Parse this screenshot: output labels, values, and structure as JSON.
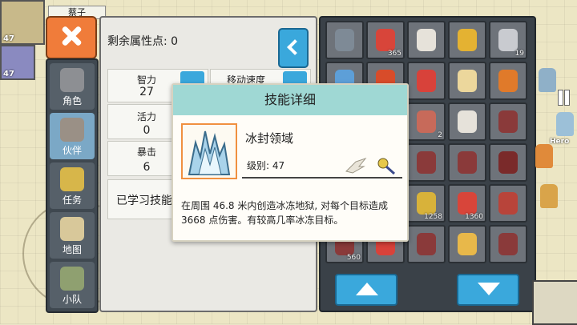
{
  "player": {
    "name": "蔡子",
    "portraits": [
      {
        "level": "47"
      },
      {
        "level": "47"
      }
    ]
  },
  "side_menu": {
    "items": [
      {
        "label": "角色",
        "icon": "helmet-icon"
      },
      {
        "label": "伙伴",
        "icon": "horned-helmet-icon"
      },
      {
        "label": "任务",
        "icon": "trophy-icon"
      },
      {
        "label": "地图",
        "icon": "scroll-map-icon"
      },
      {
        "label": "小队",
        "icon": "party-icon"
      }
    ]
  },
  "attributes": {
    "remaining_label": "剩余属性点: 0",
    "stats": [
      {
        "label": "智力",
        "value": "27"
      },
      {
        "label": "移动速度",
        "value": ""
      },
      {
        "label": "活力",
        "value": "0"
      },
      {
        "label": "暴击",
        "value": "6"
      }
    ],
    "learned_label": "已学习技能"
  },
  "inventory": {
    "slots": [
      {
        "icon": "bow-icon",
        "count": ""
      },
      {
        "icon": "red-potion-icon",
        "count": "365"
      },
      {
        "icon": "white-crystal-icon",
        "count": ""
      },
      {
        "icon": "gold-ring-icon",
        "count": ""
      },
      {
        "icon": "iron-ingot-icon",
        "count": "19"
      },
      {
        "icon": "blue-bow-icon",
        "count": ""
      },
      {
        "icon": "scroll-icon",
        "count": ""
      },
      {
        "icon": "red-gem-icon",
        "count": ""
      },
      {
        "icon": "yellow-crystal-icon",
        "count": ""
      },
      {
        "icon": "orange-mask-icon",
        "count": ""
      },
      {
        "icon": "",
        "count": ""
      },
      {
        "icon": "",
        "count": ""
      },
      {
        "icon": "meat-icon",
        "count": "2"
      },
      {
        "icon": "white-crystal-icon",
        "count": ""
      },
      {
        "icon": "spell-book-icon",
        "count": ""
      },
      {
        "icon": "",
        "count": ""
      },
      {
        "icon": "",
        "count": ""
      },
      {
        "icon": "spell-book-icon",
        "count": ""
      },
      {
        "icon": "spell-book-icon",
        "count": ""
      },
      {
        "icon": "red-armor-icon",
        "count": ""
      },
      {
        "icon": "",
        "count": ""
      },
      {
        "icon": "",
        "count": ""
      },
      {
        "icon": "gold-key-icon",
        "count": "1258"
      },
      {
        "icon": "red-potion-icon",
        "count": "1360"
      },
      {
        "icon": "red-feather-icon",
        "count": ""
      },
      {
        "icon": "spell-book-icon",
        "count": "560"
      },
      {
        "icon": "red-gem-icon",
        "count": ""
      },
      {
        "icon": "spell-book-icon",
        "count": ""
      },
      {
        "icon": "yellow-gem-icon",
        "count": ""
      },
      {
        "icon": "spell-book-icon",
        "count": ""
      }
    ]
  },
  "right_strip": {
    "hero_label": "Hero"
  },
  "skill_modal": {
    "title": "技能详细",
    "skill_name": "冰封领域",
    "level_text": "级别: 47",
    "description": "在周围 46.8 米内创造冰冻地狱, 对每个目标造成 3668 点伤害。有较高几率冰冻目标。",
    "icon": "ice-shard-icon"
  },
  "colors": {
    "accent_blue": "#3aa8dc",
    "close_orange": "#f07c3a",
    "modal_header": "#9fd8d4",
    "skill_frame": "#f09040"
  }
}
